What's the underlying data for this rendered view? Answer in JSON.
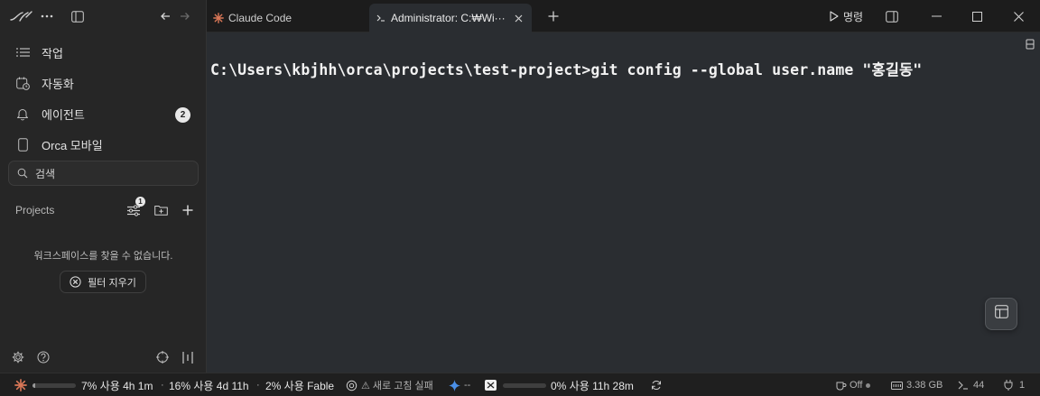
{
  "sidebar": {
    "nav": [
      {
        "label": "작업",
        "icon": "list-icon"
      },
      {
        "label": "자동화",
        "icon": "calendar-clock-icon"
      },
      {
        "label": "에이전트",
        "icon": "bell-icon",
        "badge": "2"
      },
      {
        "label": "Orca 모바일",
        "icon": "mobile-icon"
      }
    ],
    "search_placeholder": "검색",
    "projects_label": "Projects",
    "filter_badge": "1",
    "empty_message": "워크스페이스를 찾을 수 없습니다.",
    "clear_filter_label": "필터 지우기"
  },
  "tabs": [
    {
      "label": "Claude Code",
      "icon": "claude-sparkle-icon",
      "active": false
    },
    {
      "label": "Administrator: C:₩Wi···",
      "icon": "terminal-icon",
      "active": true
    }
  ],
  "titlebar": {
    "run_label": "명령"
  },
  "terminal": {
    "line": "C:\\Users\\kbjhh\\orca\\projects\\test-project>git config --global user.name \"홍길동\""
  },
  "statusbar": {
    "usage_1": "7% 사용 4h 1m",
    "usage_1_percent": 7,
    "usage_2": "16% 사용 4d 11h",
    "usage_3": "2% 사용 Fable",
    "refresh_fail": "⚠ 새로 고침 실패",
    "dash": "--",
    "usage_4": "0% 사용 11h 28m",
    "usage_4_percent": 0,
    "sleep": "Off",
    "memory": "3.38 GB",
    "terminals": "44",
    "ports": "1",
    "sep": "·"
  },
  "colors": {
    "accent_claude": "#d97757",
    "terminal_bg": "#2a2d31",
    "sidebar_bg": "#262626"
  }
}
